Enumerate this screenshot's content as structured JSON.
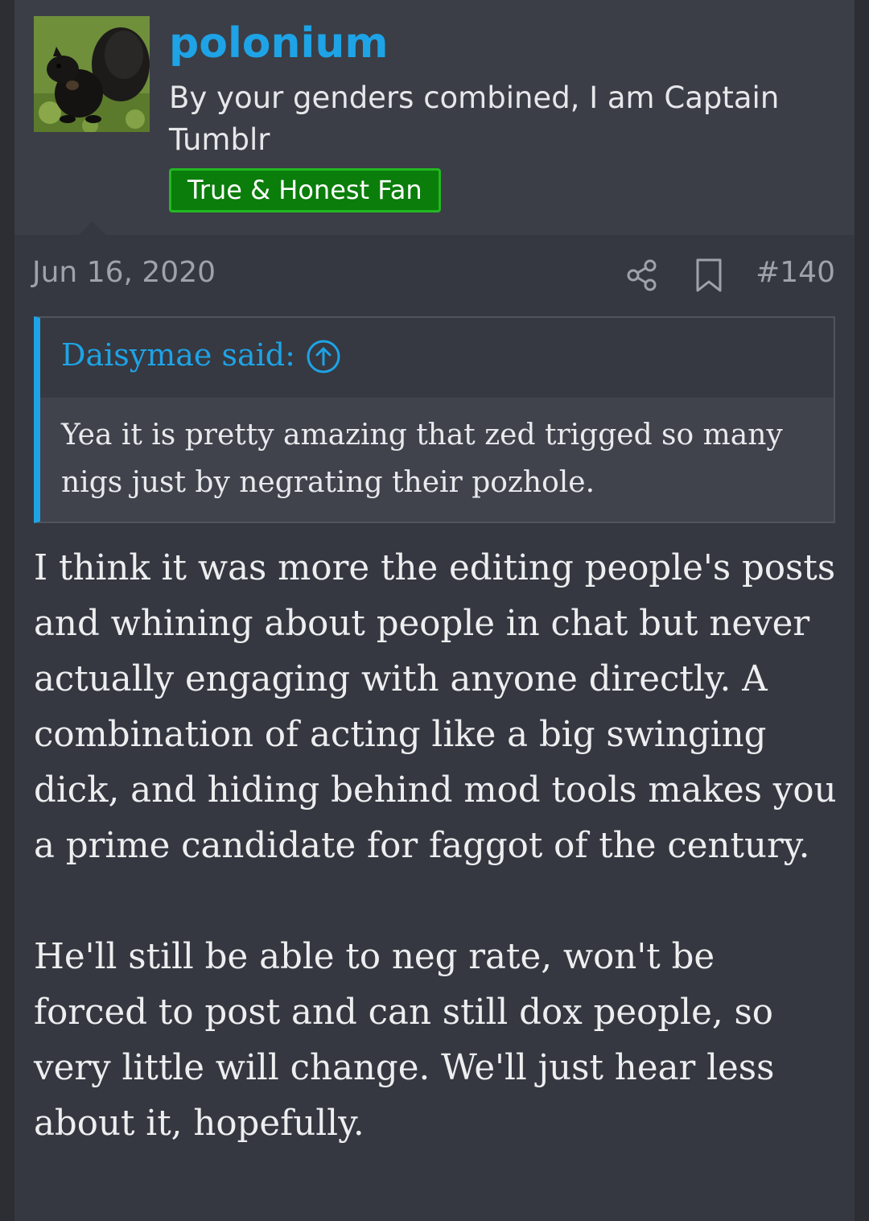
{
  "user": {
    "username": "polonium",
    "title": "By your genders combined, I am Captain Tumblr",
    "badge": "True & Honest Fan",
    "avatar": "black-squirrel-avatar"
  },
  "post_meta": {
    "date": "Jun 16, 2020",
    "number": "#140",
    "icons": [
      "share-icon",
      "bookmark-icon"
    ]
  },
  "quote": {
    "author": "Daisymae said:",
    "text": "Yea it is pretty amazing that zed trigged so many nigs just by negrating their pozhole."
  },
  "body": {
    "paragraphs": [
      "I think it was more the editing people's posts and whining about people in chat but never actually engaging with anyone directly. A combination of acting like a big swinging dick, and hiding behind mod tools makes you a prime candidate for faggot of the century.",
      "He'll still be able to neg rate, won't be forced to post and can still dox people, so very little will change. We'll just hear less about it, hopefully."
    ]
  },
  "colors": {
    "link": "#1ea3e6",
    "badge_bg": "#0a7d0a",
    "badge_border": "#22b822",
    "page_bg": "#353840",
    "header_bg": "#3b3e46"
  }
}
